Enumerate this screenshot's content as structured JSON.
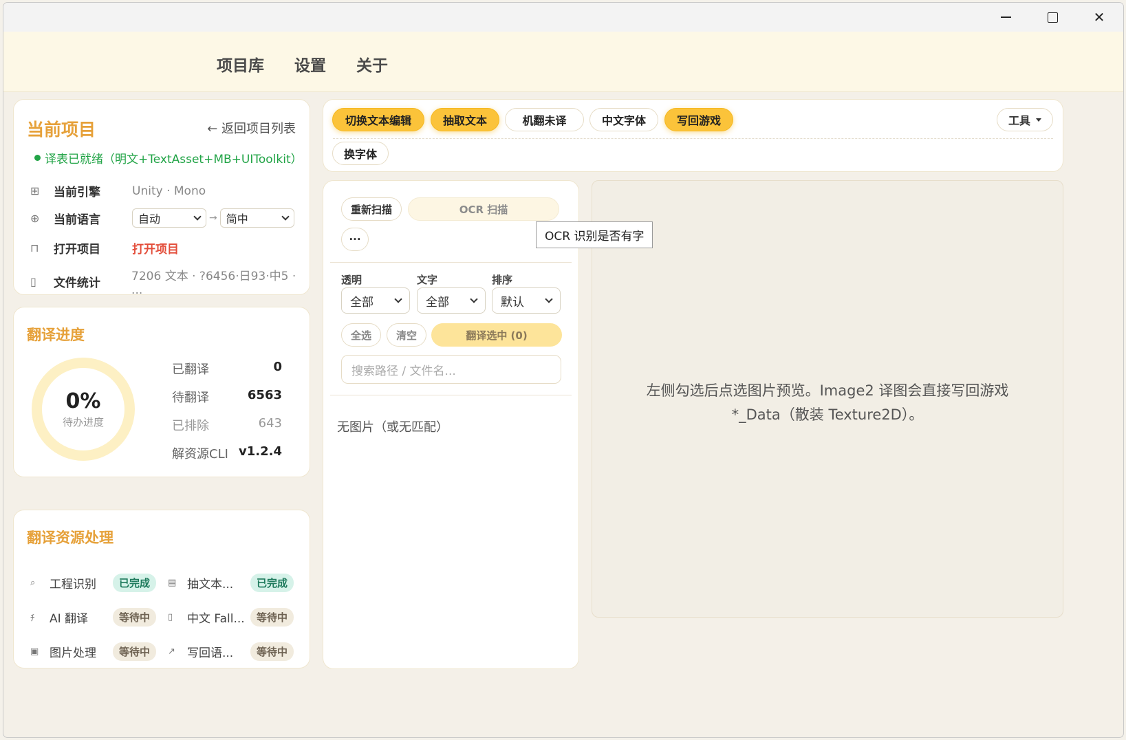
{
  "nav": [
    "项目库",
    "设置",
    "关于"
  ],
  "project": {
    "title": "当前项目",
    "back": "← 返回项目列表",
    "status": "译表已就绪（明文+TextAsset+MB+UIToolkit）",
    "engine_label": "当前引擎",
    "engine_value": "Unity · Mono",
    "lang_label": "当前语言",
    "lang_from": "自动",
    "lang_arrow": "→",
    "lang_to": "简中",
    "open_label": "打开项目",
    "open_value": "打开项目",
    "stats_label": "文件统计",
    "stats_value": "7206 文本 · ?6456·日93·中5 · ..."
  },
  "progress": {
    "title": "翻译进度",
    "percent": "0%",
    "percent_sub": "待办进度",
    "rows": [
      {
        "k": "已翻译",
        "v": "0"
      },
      {
        "k": "待翻译",
        "v": "6563"
      },
      {
        "k": "已排除",
        "v": "643"
      },
      {
        "k": "解资源CLI",
        "v": "v1.2.4"
      }
    ]
  },
  "pipeline": {
    "title": "翻译资源处理",
    "tasks": [
      {
        "name": "工程识别",
        "icon": "search-icon",
        "glyph": "⌕",
        "status": "已完成",
        "state": "done"
      },
      {
        "name": "抽文本...",
        "icon": "document-icon",
        "glyph": "▤",
        "status": "已完成",
        "state": "done"
      },
      {
        "name": "AI 翻译",
        "icon": "translate-icon",
        "glyph": "ﾁ",
        "status": "等待中",
        "state": "wait"
      },
      {
        "name": "中文 Fall...",
        "icon": "bookmark-icon",
        "glyph": "▯",
        "status": "等待中",
        "state": "wait"
      },
      {
        "name": "图片处理",
        "icon": "image-icon",
        "glyph": "▣",
        "status": "等待中",
        "state": "wait"
      },
      {
        "name": "写回语...",
        "icon": "trend-icon",
        "glyph": "↗",
        "status": "等待中",
        "state": "wait"
      }
    ]
  },
  "toolbar": {
    "buttons": [
      "切换文本编辑",
      "抽取文本",
      "机翻未译",
      "中文字体",
      "写回游戏",
      "换字体"
    ],
    "tools": "工具"
  },
  "images": {
    "rescan": "重新扫描",
    "ocr": "OCR 扫描",
    "more": "···",
    "tooltip": "OCR 识别是否有字",
    "filter_labels": [
      "透明",
      "文字",
      "排序"
    ],
    "filter_values": [
      "全部",
      "全部",
      "默认"
    ],
    "select_all": "全选",
    "clear": "清空",
    "translate_selected": "翻译选中 (0)",
    "search_placeholder": "搜索路径 / 文件名...",
    "empty": "无图片（或无匹配）"
  },
  "preview": {
    "line1": "左侧勾选后点选图片预览。Image2 译图会直接写回游戏",
    "line2": "*_Data（散装 Texture2D）。"
  }
}
